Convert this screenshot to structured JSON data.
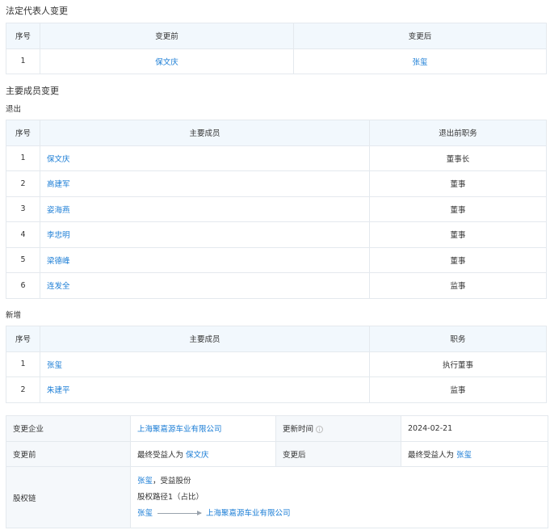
{
  "legal_rep": {
    "title": "法定代表人变更",
    "headers": {
      "index": "序号",
      "before": "变更前",
      "after": "变更后"
    },
    "rows": [
      {
        "index": "1",
        "before": "保文庆",
        "after": "张玺"
      }
    ]
  },
  "members": {
    "title": "主要成员变更",
    "exit": {
      "title": "退出",
      "headers": {
        "index": "序号",
        "member": "主要成员",
        "role": "退出前职务"
      },
      "rows": [
        {
          "index": "1",
          "name": "保文庆",
          "role": "董事长"
        },
        {
          "index": "2",
          "name": "高建军",
          "role": "董事"
        },
        {
          "index": "3",
          "name": "姿海燕",
          "role": "董事"
        },
        {
          "index": "4",
          "name": "李忠明",
          "role": "董事"
        },
        {
          "index": "5",
          "name": "梁德峰",
          "role": "董事"
        },
        {
          "index": "6",
          "name": "连发全",
          "role": "监事"
        }
      ]
    },
    "added": {
      "title": "新增",
      "headers": {
        "index": "序号",
        "member": "主要成员",
        "role": "职务"
      },
      "rows": [
        {
          "index": "1",
          "name": "张玺",
          "role": "执行董事"
        },
        {
          "index": "2",
          "name": "朱建平",
          "role": "监事"
        }
      ]
    }
  },
  "beneficiary": {
    "company_label": "变更企业",
    "company_value": "上海聚嘉源车业有限公司",
    "update_label": "更新时间",
    "info_icon": "i",
    "update_value": "2024-02-21",
    "before_label": "变更前",
    "before_prefix": "最终受益人为",
    "before_name": "保文庆",
    "after_label": "变更后",
    "after_prefix": "最终受益人为",
    "after_name": "张玺",
    "chain_label": "股权链",
    "chain_holder": "张玺",
    "chain_holder_suffix": "，受益股份",
    "chain_path": "股权路径1（占比）",
    "chain_from": "张玺",
    "chain_to": "上海聚嘉源车业有限公司"
  }
}
